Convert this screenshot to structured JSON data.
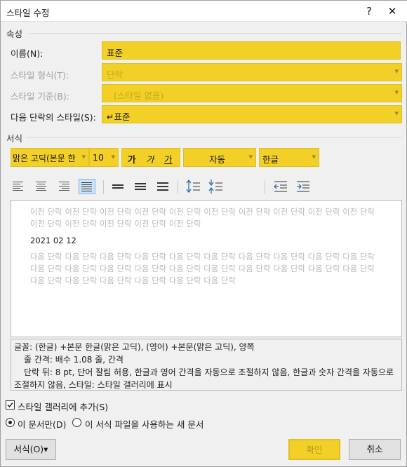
{
  "window": {
    "title": "스타일 수정",
    "help": "?",
    "close": "✕"
  },
  "properties": {
    "section": "속성",
    "name_label": "이름(N):",
    "name_value": "표준",
    "type_label": "스타일 형식(T):",
    "type_value": "단락",
    "based_label": "스타일 기준(B):",
    "based_value": "(스타일 없음)",
    "next_label": "다음 단락의 스타일(S):",
    "next_value": "↵표준"
  },
  "format": {
    "section": "서식",
    "font": "맑은 고딕(본문 한",
    "size": "10",
    "bold": "가",
    "italic": "가",
    "underline": "가",
    "color": "자동",
    "script": "한글"
  },
  "preview": {
    "prev_text": "이전 단락 이전 단락 이전 단락 이전 단락 이전 단락 이전 단락 이전 단락 이전 단락 이전 단락 이전 단락 이전 단락 이전 단락 이전 단락 이전 단락 이전 단락",
    "sample": "2021 02 12",
    "next_text": "다음 단락 다음 단락 다음 단락 다음 단락 다음 단락 다음 단락 다음 단락 다음 단락 다음 단락 다음 단락 다음 단락 다음 단락 다음 단락 다음 단락 다음 단락 다음 단락 다음 단락 다음 단락 다음 단락 다음 단락 다음 단락 다음 단락 다음 단락 다음 단락 다음 단락 다음 단락"
  },
  "description": {
    "line1": "글꼴: (한글) +본문 한글(맑은 고딕), (영어) +본문(맑은 고딕), 양쪽",
    "line2": "줄 간격: 배수 1.08 줄, 간격",
    "line3": "단락 뒤: 8 pt, 단어 잘림 허용, 한글과 영어 간격을 자동으로 조절하지 않음, 한글과 숫자 간격을 자동으로 조절하지 않음, 스타일: 스타일 갤러리에 표시"
  },
  "options": {
    "gallery_label": "스타일 갤러리에 추가(S)",
    "doc_only_label": "이 문서만(D)",
    "template_label": "이 서식 파일을 사용하는 새 문서"
  },
  "buttons": {
    "format": "서식(O)▾",
    "ok": "확인",
    "cancel": "취소"
  },
  "colors": {
    "highlight": "#f2d027"
  }
}
